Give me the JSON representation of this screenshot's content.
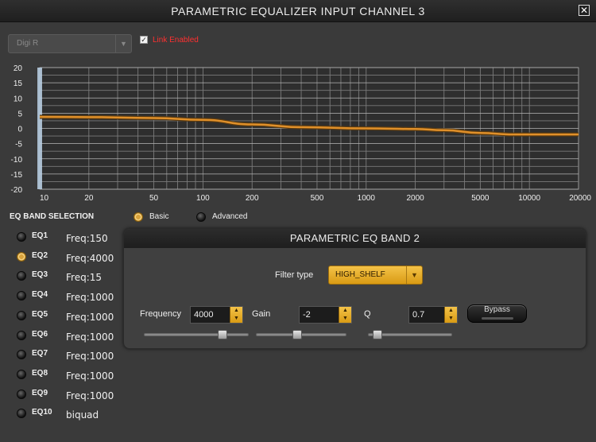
{
  "window": {
    "title": "PARAMETRIC EQUALIZER INPUT CHANNEL 3",
    "close_glyph": "✕"
  },
  "device": {
    "selected": "Digi R"
  },
  "link": {
    "label": "Link Enabled",
    "checked": true
  },
  "colors": {
    "curve": "#e0902a",
    "accent": "#e5ac2d",
    "link_label": "#ff3030"
  },
  "chart_data": {
    "type": "line",
    "x_scale": "log",
    "xlim": [
      10,
      20000
    ],
    "ylim": [
      -20,
      20
    ],
    "x_ticks": [
      10,
      20,
      50,
      100,
      200,
      500,
      1000,
      2000,
      5000,
      10000,
      20000
    ],
    "y_ticks": [
      20,
      15,
      10,
      5,
      0,
      -5,
      -10,
      -15,
      -20
    ],
    "grid": true,
    "series": [
      {
        "x": [
          10,
          20,
          50,
          100,
          200,
          400,
          1000,
          2000,
          3000,
          5000,
          8000,
          20000
        ],
        "y": [
          3.8,
          3.7,
          3.4,
          2.8,
          1.3,
          0.4,
          0.0,
          -0.2,
          -0.6,
          -1.5,
          -2.0,
          -2.0
        ]
      }
    ]
  },
  "band_selection": {
    "title": "EQ BAND SELECTION",
    "modes": [
      {
        "label": "Basic",
        "selected": true
      },
      {
        "label": "Advanced",
        "selected": false
      }
    ],
    "bands": [
      {
        "label": "EQ1",
        "freq": "Freq:150",
        "selected": false
      },
      {
        "label": "EQ2",
        "freq": "Freq:4000",
        "selected": true
      },
      {
        "label": "EQ3",
        "freq": "Freq:15",
        "selected": false
      },
      {
        "label": "EQ4",
        "freq": "Freq:1000",
        "selected": false
      },
      {
        "label": "EQ5",
        "freq": "Freq:1000",
        "selected": false
      },
      {
        "label": "EQ6",
        "freq": "Freq:1000",
        "selected": false
      },
      {
        "label": "EQ7",
        "freq": "Freq:1000",
        "selected": false
      },
      {
        "label": "EQ8",
        "freq": "Freq:1000",
        "selected": false
      },
      {
        "label": "EQ9",
        "freq": "Freq:1000",
        "selected": false
      },
      {
        "label": "EQ10",
        "freq": "biquad",
        "selected": false
      }
    ]
  },
  "band_panel": {
    "title": "PARAMETRIC EQ BAND 2",
    "filter_type_label": "Filter type",
    "filter_type": "HIGH_SHELF",
    "frequency_label": "Frequency",
    "frequency": "4000",
    "gain_label": "Gain",
    "gain": "-2",
    "q_label": "Q",
    "q": "0.7",
    "bypass_label": "Bypass",
    "frequency_slider_fraction": 0.78,
    "gain_slider_fraction": 0.45,
    "q_slider_fraction": 0.05
  }
}
